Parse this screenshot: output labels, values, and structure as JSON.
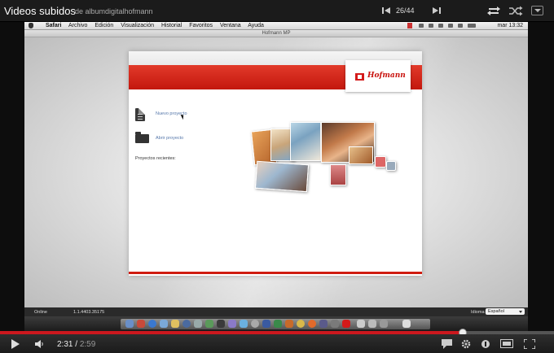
{
  "playlist": {
    "title": "Videos subidos",
    "channel": "de albumdigitalhofmann",
    "position": "26/44"
  },
  "mac_menu": {
    "items": [
      "Safari",
      "Archivo",
      "Edición",
      "Visualización",
      "Historial",
      "Favoritos",
      "Ventana",
      "Ayuda"
    ],
    "clock": "mar 13:32"
  },
  "window_title": "Hofmann MP",
  "app": {
    "brand": "Hofmann",
    "new_project": "Nuevo proyecto",
    "open_project": "Abrir proyecto",
    "recent_projects": "Proyectos recientes:"
  },
  "statusbar": {
    "status": "Online",
    "version": "1.1.4403.35175",
    "language_label": "Idioma:",
    "language_value": "Español"
  },
  "player": {
    "current_time": "2:31",
    "duration": "2:59",
    "progress": 0.836,
    "accent": "#cc181e"
  },
  "colors": {
    "brand_red": "#cc1a10"
  }
}
